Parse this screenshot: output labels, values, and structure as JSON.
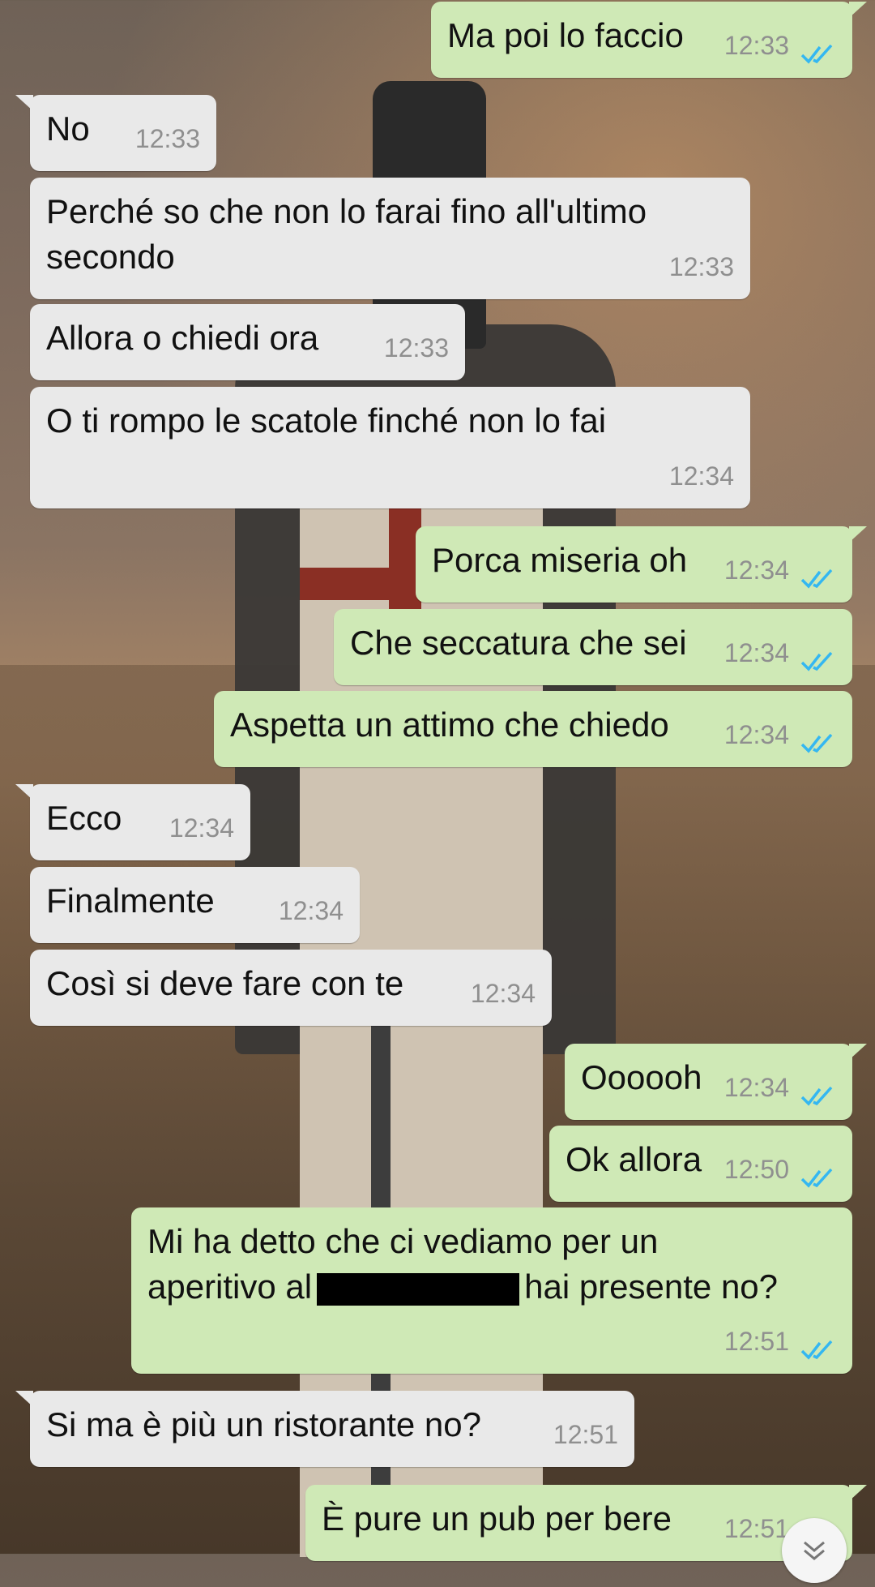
{
  "messages": [
    {
      "dir": "out",
      "text": "Ma poi lo faccio",
      "time": "12:33",
      "read": true
    },
    {
      "dir": "in",
      "text": "No",
      "time": "12:33"
    },
    {
      "dir": "in",
      "lines": [
        "Perché so che non lo farai fino all'ultimo",
        "secondo"
      ],
      "time": "12:33"
    },
    {
      "dir": "in",
      "text": "Allora o chiedi ora",
      "time": "12:33"
    },
    {
      "dir": "in",
      "text": "O ti rompo le scatole finché non lo fai",
      "time": "12:34"
    },
    {
      "dir": "out",
      "text": "Porca miseria oh",
      "time": "12:34",
      "read": true
    },
    {
      "dir": "out",
      "text": "Che seccatura che sei",
      "time": "12:34",
      "read": true
    },
    {
      "dir": "out",
      "text": "Aspetta un attimo che chiedo",
      "time": "12:34",
      "read": true
    },
    {
      "dir": "in",
      "text": "Ecco",
      "time": "12:34"
    },
    {
      "dir": "in",
      "text": "Finalmente",
      "time": "12:34"
    },
    {
      "dir": "in",
      "text": "Così si deve fare con te",
      "time": "12:34"
    },
    {
      "dir": "out",
      "text": "Oooooh",
      "time": "12:34",
      "read": true
    },
    {
      "dir": "out",
      "text": "Ok allora",
      "time": "12:50",
      "read": true
    },
    {
      "dir": "out",
      "line1": "Mi ha detto che ci vediamo per un",
      "line2_start": "aperitivo al",
      "line2_end": "hai presente no?",
      "time": "12:51",
      "read": true
    },
    {
      "dir": "in",
      "text": "Si ma è più un ristorante no?",
      "time": "12:51"
    },
    {
      "dir": "out",
      "text": "È pure un pub per bere",
      "time": "12:51",
      "read": true
    }
  ],
  "colors": {
    "incoming": "#e9e9e9",
    "outgoing": "#cfe9b6",
    "tick": "#34b7f1",
    "time": "#8f8f8f"
  },
  "icons": {
    "read": "double-check-icon",
    "scroll": "chevron-down-icon"
  }
}
